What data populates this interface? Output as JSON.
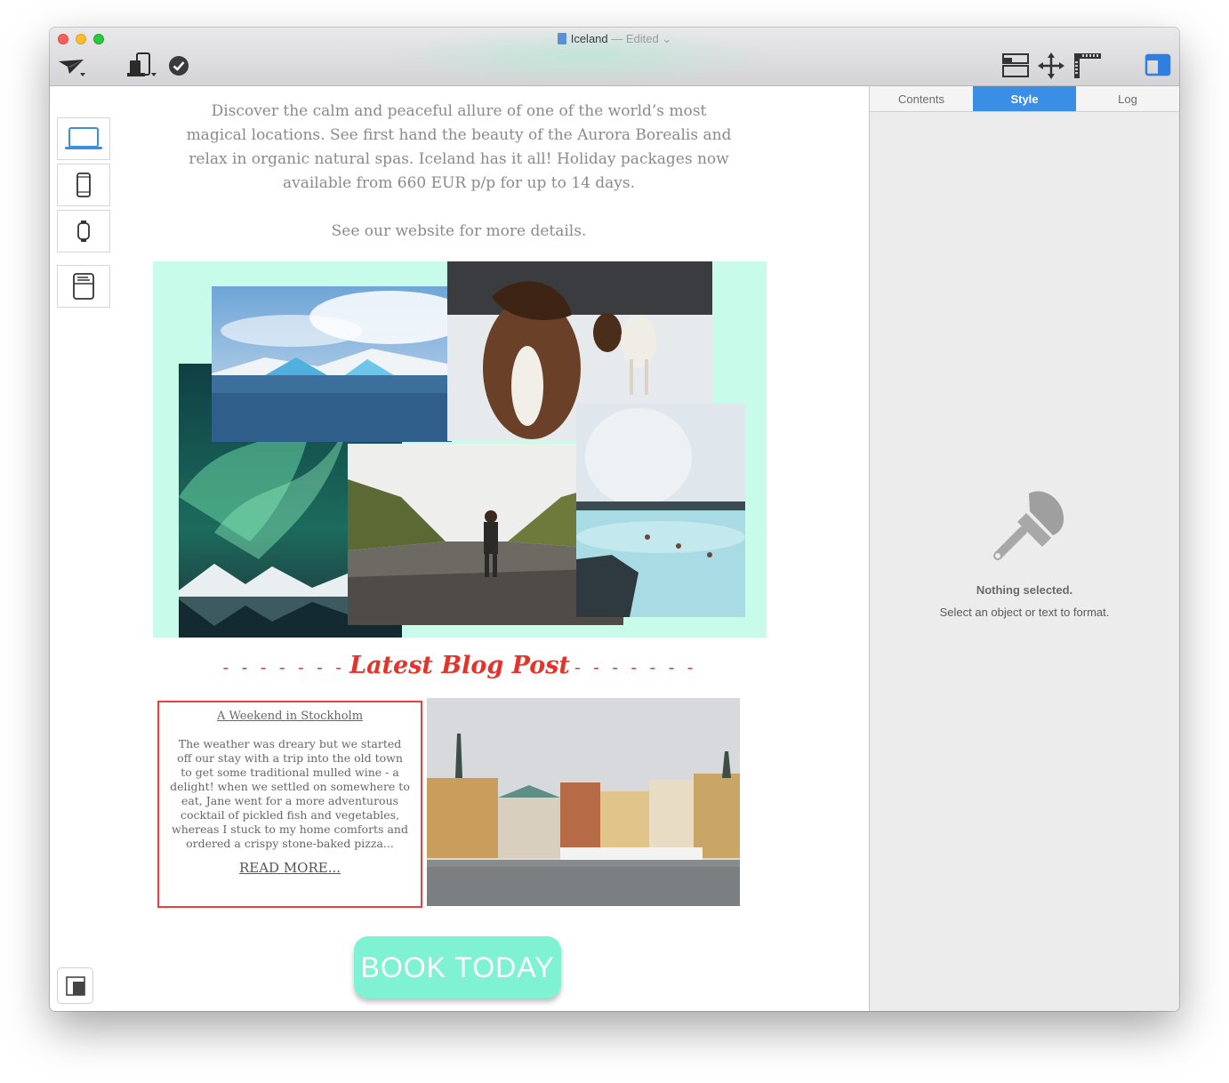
{
  "window": {
    "title": "Iceland",
    "status": "— Edited"
  },
  "toolbar": {
    "left_icons": [
      "send-icon",
      "devices-icon",
      "check-icon"
    ],
    "right_icons": [
      "layout-icon",
      "move-icon",
      "ruler-icon",
      "sidebar-toggle-icon"
    ]
  },
  "device_rail": {
    "items": [
      "laptop-icon",
      "phone-icon",
      "watch-icon",
      "email-client-icon"
    ],
    "active": "laptop-icon"
  },
  "content": {
    "intro": "Discover the calm and peaceful allure of one of the world’s most magical locations. See first hand the beauty of the Aurora Borealis and relax in organic natural spas. Iceland has it all! Holiday packages now available from 660 EUR p/p for up to 14 days.",
    "website_note": "See our website for more details.",
    "blog_heading": "Latest Blog Post",
    "blog_dashes": "- - - - - - -",
    "post": {
      "title": "A Weekend in Stockholm",
      "body": "The weather was dreary but we started off our stay with a trip into the old town to get some traditional mulled wine - a delight! when we settled on somewhere to eat, Jane went for a more adventurous cocktail of pickled fish and vegetables, whereas I stuck to my home comforts and ordered a crispy stone-baked pizza...",
      "read_more": "READ MORE..."
    },
    "cta": "BOOK TODAY"
  },
  "inspector": {
    "tabs": [
      "Contents",
      "Style",
      "Log"
    ],
    "active_tab": "Style",
    "empty_title": "Nothing selected.",
    "empty_hint": "Select an object or text to format."
  },
  "colors": {
    "accent": "#3b8ee6",
    "collage_bg": "#c9fbea",
    "cta": "#7ef2d2",
    "blog_red": "#e8312a"
  }
}
